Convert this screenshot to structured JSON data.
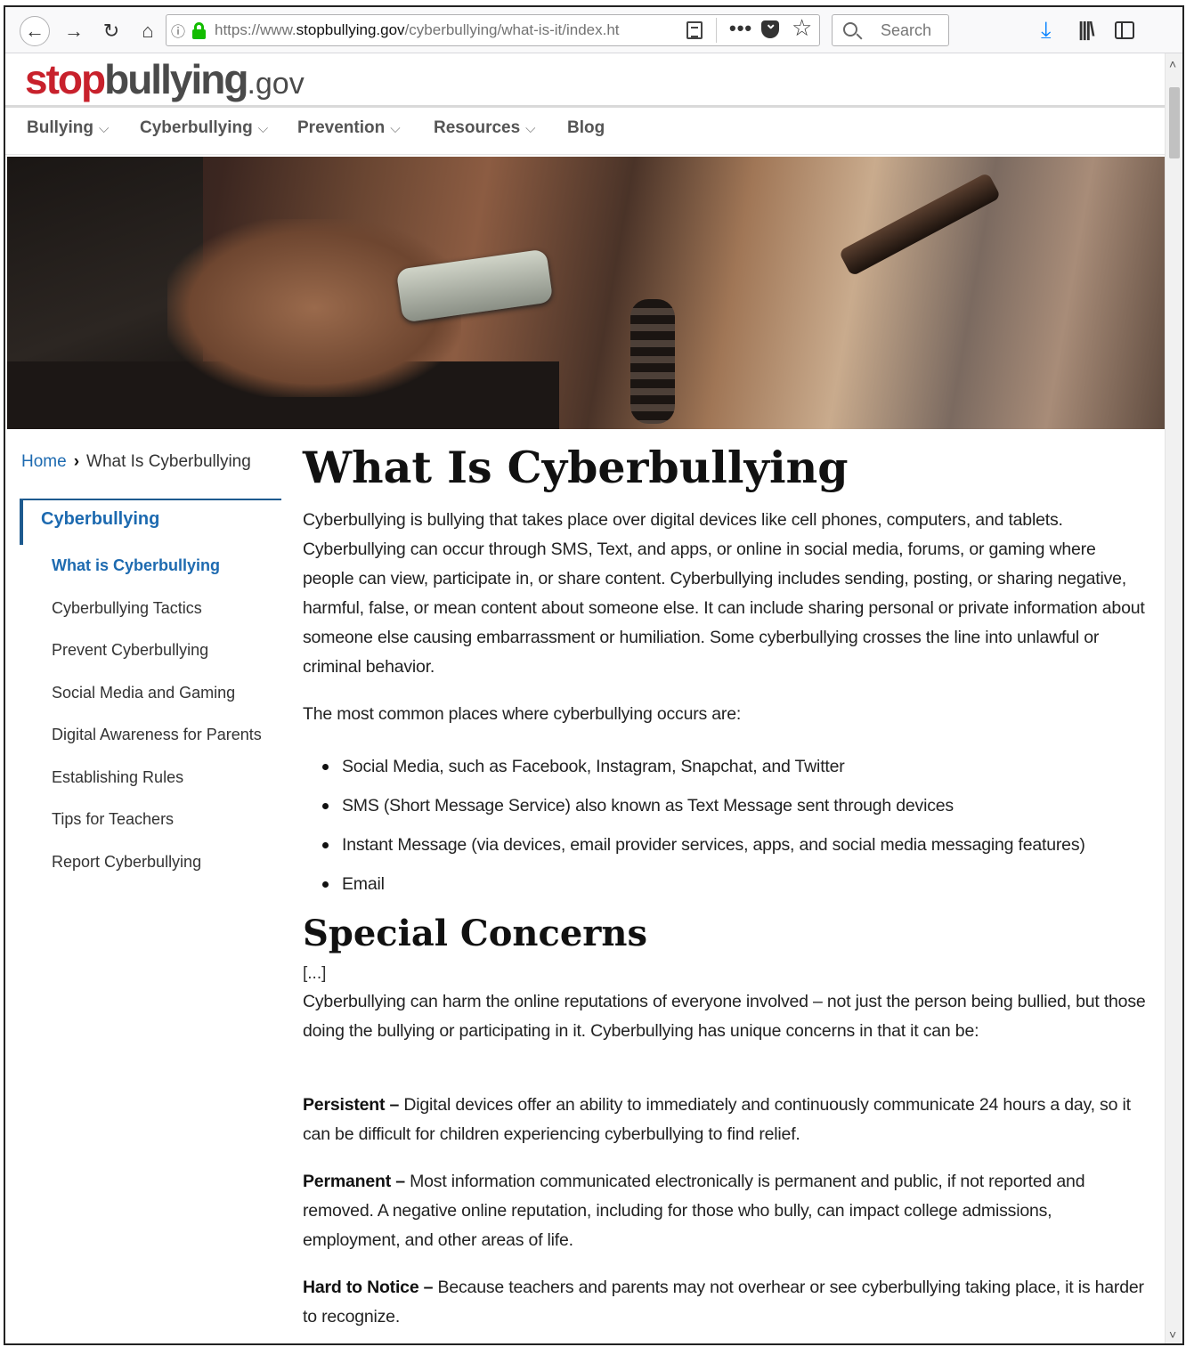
{
  "browser": {
    "url_prefix": "https://www.",
    "url_domain": "stopbullying.gov",
    "url_path": "/cyberbullying/what-is-it/index.ht",
    "search_placeholder": "Search",
    "more_label": "•••"
  },
  "site": {
    "logo_stop": "stop",
    "logo_bullying": "bullying",
    "logo_gov": ".gov"
  },
  "nav": {
    "items": [
      {
        "label": "Bullying",
        "chevron": "⌵"
      },
      {
        "label": "Cyberbullying",
        "chevron": "⌵"
      },
      {
        "label": "Prevention",
        "chevron": "⌵"
      },
      {
        "label": "Resources",
        "chevron": "⌵"
      },
      {
        "label": "Blog"
      }
    ]
  },
  "breadcrumb": {
    "home": "Home",
    "separator": "›",
    "current": "What Is Cyberbullying"
  },
  "sidebar": {
    "heading": "Cyberbullying",
    "items": [
      {
        "label": "What is Cyberbullying",
        "active": true
      },
      {
        "label": "Cyberbullying Tactics"
      },
      {
        "label": "Prevent Cyberbullying"
      },
      {
        "label": "Social Media and Gaming"
      },
      {
        "label": "Digital Awareness for Parents"
      },
      {
        "label": "Establishing Rules"
      },
      {
        "label": "Tips for Teachers"
      },
      {
        "label": "Report Cyberbullying"
      }
    ]
  },
  "main": {
    "title": "What Is Cyberbullying",
    "intro": "Cyberbullying is bullying that takes place over digital devices like cell phones, computers, and tablets. Cyberbullying can occur through SMS, Text, and apps, or online in social media, forums, or gaming where people can view, participate in, or share content. Cyberbullying includes sending, posting, or sharing negative, harmful, false, or mean content about someone else. It can include sharing personal or private information about someone else causing embarrassment or humiliation. Some cyberbullying crosses the line into unlawful or criminal behavior.",
    "places_intro": "The most common places where cyberbullying occurs are:",
    "places": [
      "Social Media, such as Facebook, Instagram, Snapchat, and Twitter",
      "SMS (Short Message Service) also known as Text Message sent through devices",
      "Instant Message (via devices, email provider services, apps, and social media messaging features)",
      "Email"
    ],
    "special_title": "Special Concerns",
    "ellipsis": "[...]",
    "special_intro": "Cyberbullying can harm the online reputations of everyone involved – not just the person being bullied, but those doing the bullying or participating in it. Cyberbullying has unique concerns in that it can be:",
    "concerns": [
      {
        "term": "Persistent –",
        "text": " Digital devices offer an ability to immediately and continuously communicate 24 hours a day, so it can be difficult for children experiencing cyberbullying to find relief."
      },
      {
        "term": "Permanent –",
        "text": " Most information communicated electronically is permanent and public, if not reported and removed. A negative online reputation, including for those who bully, can impact college admissions, employment, and other areas of life."
      },
      {
        "term": "Hard to Notice –",
        "text": " Because teachers and parents may not overhear or see cyberbullying taking place, it is harder to recognize."
      }
    ]
  }
}
